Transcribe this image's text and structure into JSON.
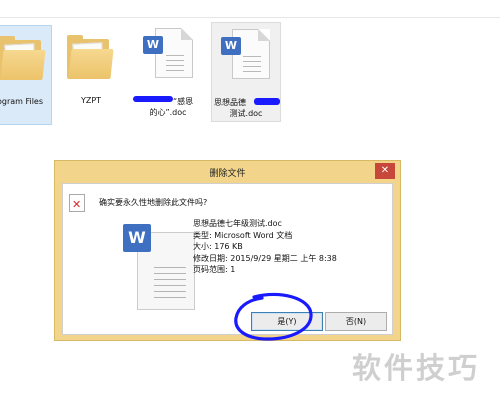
{
  "explorer": {
    "files": [
      {
        "label": "ogram Files",
        "kind": "folder"
      },
      {
        "label": "YZPT",
        "kind": "folder"
      },
      {
        "label_line1": "“感恩",
        "label_line2": "的心”.doc",
        "kind": "doc"
      },
      {
        "label_line1": "思想品德",
        "label_line2": "测试.doc",
        "kind": "doc"
      }
    ]
  },
  "dialog": {
    "title": "删除文件",
    "close_glyph": "✕",
    "question": "确实要永久性地删除此文件吗?",
    "file_info": {
      "name": "思想品德七年级测试.doc",
      "type": "类型: Microsoft Word 文档",
      "size": "大小: 176 KB",
      "modified": "修改日期: 2015/9/29 星期二 上午 8:38",
      "pages": "页码范围: 1"
    },
    "yes_label": "是(Y)",
    "no_label": "否(N)"
  },
  "icons": {
    "doc_badge": "W",
    "delete_glyph": "✕"
  },
  "colors": {
    "dialog_frame": "#f2d58b",
    "close_button": "#c7473b",
    "word_badge": "#3f6fc1",
    "annotation_ink": "#1a1aff",
    "selection": "#dbeaf8"
  },
  "watermark": "软件技巧"
}
